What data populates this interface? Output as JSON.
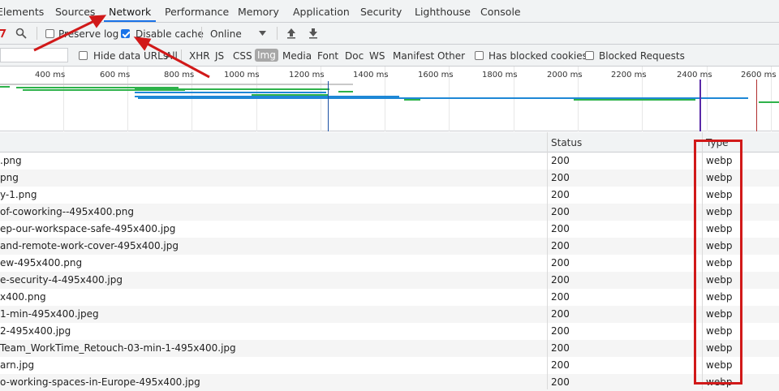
{
  "tabs": [
    {
      "label": "Elements",
      "active": false
    },
    {
      "label": "Sources",
      "active": false
    },
    {
      "label": "Network",
      "active": true
    },
    {
      "label": "Performance",
      "active": false
    },
    {
      "label": "Memory",
      "active": false
    },
    {
      "label": "Application",
      "active": false
    },
    {
      "label": "Security",
      "active": false
    },
    {
      "label": "Lighthouse",
      "active": false
    },
    {
      "label": "Console",
      "active": false
    }
  ],
  "toolbar": {
    "preserve_log": {
      "label": "Preserve log",
      "checked": false
    },
    "disable_cache": {
      "label": "Disable cache",
      "checked": true
    },
    "throttling": "Online"
  },
  "filters": {
    "hide_data_urls": {
      "label": "Hide data URLs",
      "checked": false
    },
    "types": [
      "All",
      "XHR",
      "JS",
      "CSS",
      "Img",
      "Media",
      "Font",
      "Doc",
      "WS",
      "Manifest",
      "Other"
    ],
    "selected_type": "Img",
    "has_blocked_cookies": {
      "label": "Has blocked cookies",
      "checked": false
    },
    "blocked_requests": {
      "label": "Blocked Requests",
      "checked": false
    }
  },
  "overview": {
    "ticks": [
      "400 ms",
      "600 ms",
      "800 ms",
      "1000 ms",
      "1200 ms",
      "1400 ms",
      "1600 ms",
      "1800 ms",
      "2000 ms",
      "2200 ms",
      "2400 ms",
      "2600 ms"
    ]
  },
  "table": {
    "columns": {
      "status": "Status",
      "type": "Type"
    },
    "rows": [
      {
        "name": ".png",
        "status": "200",
        "type": "webp"
      },
      {
        "name": "png",
        "status": "200",
        "type": "webp"
      },
      {
        "name": "y-1.png",
        "status": "200",
        "type": "webp"
      },
      {
        "name": "of-coworking--495x400.png",
        "status": "200",
        "type": "webp"
      },
      {
        "name": "ep-our-workspace-safe-495x400.jpg",
        "status": "200",
        "type": "webp"
      },
      {
        "name": "and-remote-work-cover-495x400.jpg",
        "status": "200",
        "type": "webp"
      },
      {
        "name": "ew-495x400.png",
        "status": "200",
        "type": "webp"
      },
      {
        "name": "e-security-4-495x400.jpg",
        "status": "200",
        "type": "webp"
      },
      {
        "name": "x400.png",
        "status": "200",
        "type": "webp"
      },
      {
        "name": "1-min-495x400.jpeg",
        "status": "200",
        "type": "webp"
      },
      {
        "name": "2-495x400.jpg",
        "status": "200",
        "type": "webp"
      },
      {
        "name": "Team_WorkTime_Retouch-03-min-1-495x400.jpg",
        "status": "200",
        "type": "webp"
      },
      {
        "name": "arn.jpg",
        "status": "200",
        "type": "webp"
      },
      {
        "name": "o-working-spaces-in-Europe-495x400.jpg",
        "status": "200",
        "type": "webp"
      }
    ]
  },
  "colors": {
    "accent": "#1a73e8",
    "annotation": "#d11919",
    "waterfall_green": "#2eb24a",
    "waterfall_blue": "#1e88d6"
  }
}
